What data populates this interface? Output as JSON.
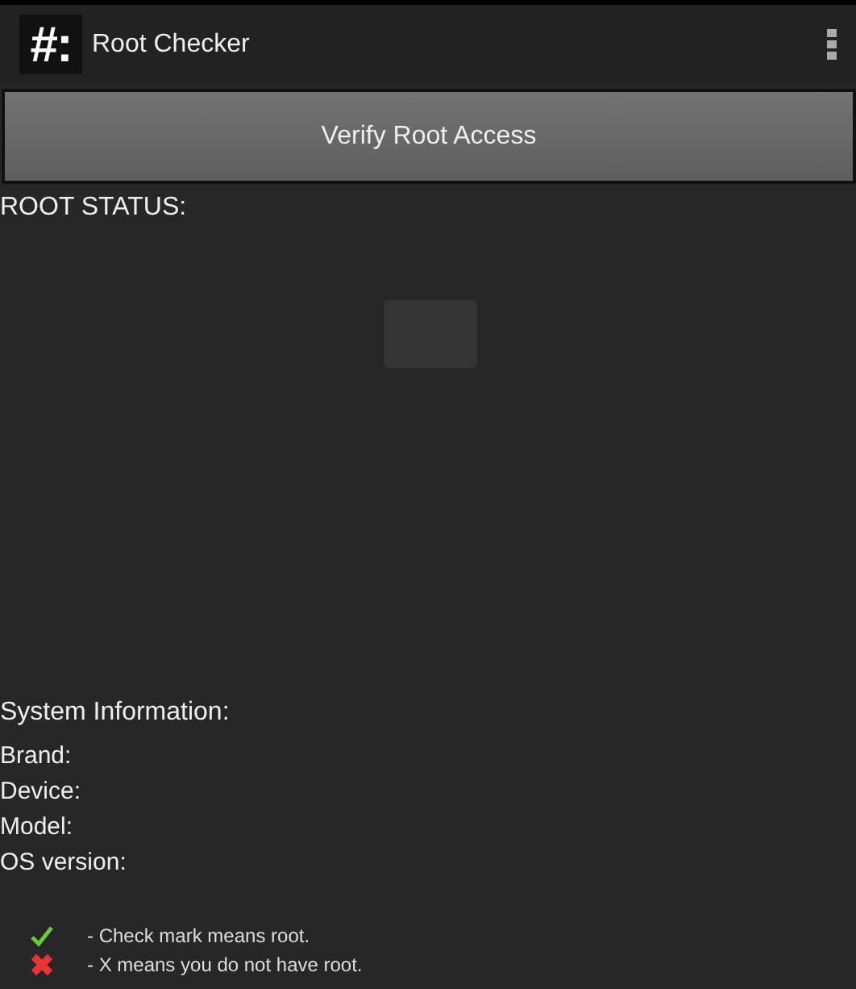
{
  "action_bar": {
    "logo": "#:",
    "title": "Root Checker"
  },
  "verify_button": {
    "label": "Verify Root Access"
  },
  "root_status": {
    "label": "ROOT STATUS:"
  },
  "system_info": {
    "heading": "System Information:",
    "fields": [
      {
        "label": "Brand:"
      },
      {
        "label": "Device:"
      },
      {
        "label": "Model:"
      },
      {
        "label": "OS version:"
      }
    ]
  },
  "legend": [
    {
      "kind": "check",
      "text": "- Check mark means root."
    },
    {
      "kind": "cross",
      "text": "- X means you do not have root."
    }
  ]
}
